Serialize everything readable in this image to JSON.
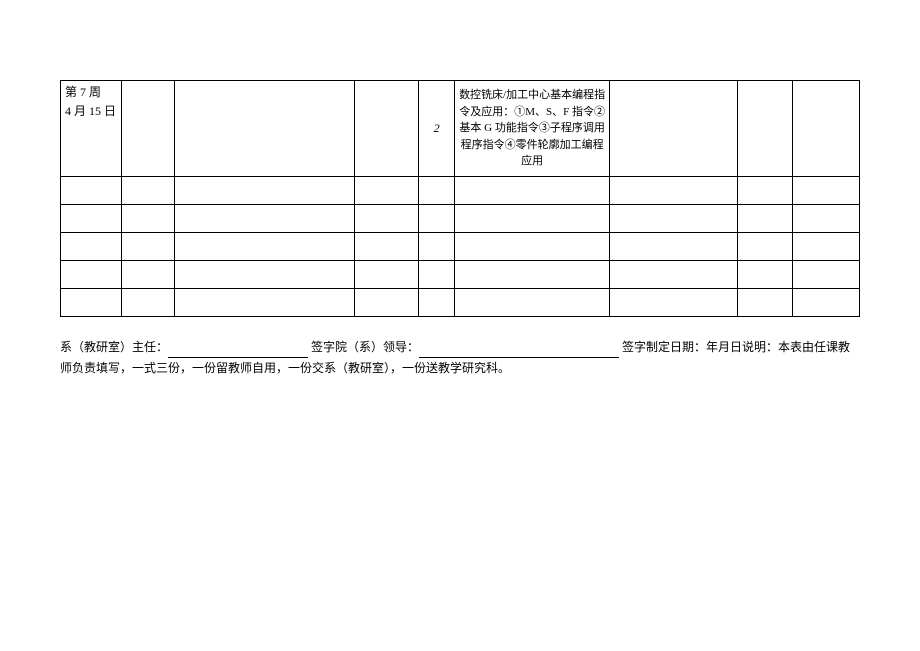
{
  "table": {
    "rows": [
      {
        "week": "第 7 周\n4 月 15 日",
        "col2": "",
        "col3": "",
        "col4": "",
        "hours": "2",
        "content": "数控铣床/加工中心基本编程指令及应用：①M、S、F 指令②基本 G 功能指令③子程序调用程序指令④零件轮廓加工编程应用",
        "col7": "",
        "col8": "",
        "col9": ""
      },
      {
        "week": "",
        "col2": "",
        "col3": "",
        "col4": "",
        "hours": "",
        "content": "",
        "col7": "",
        "col8": "",
        "col9": ""
      },
      {
        "week": "",
        "col2": "",
        "col3": "",
        "col4": "",
        "hours": "",
        "content": "",
        "col7": "",
        "col8": "",
        "col9": ""
      },
      {
        "week": "",
        "col2": "",
        "col3": "",
        "col4": "",
        "hours": "",
        "content": "",
        "col7": "",
        "col8": "",
        "col9": ""
      },
      {
        "week": "",
        "col2": "",
        "col3": "",
        "col4": "",
        "hours": "",
        "content": "",
        "col7": "",
        "col8": "",
        "col9": ""
      },
      {
        "week": "",
        "col2": "",
        "col3": "",
        "col4": "",
        "hours": "",
        "content": "",
        "col7": "",
        "col8": "",
        "col9": ""
      }
    ]
  },
  "footer": {
    "part1": "系（教研室）主任：",
    "part2": "签字院（系）领导：",
    "part3": "签字制定日期：年月日说明：本表由任课教师负责填写，一式三份，一份留教师自用，一份交系（教研室），一份送教学研究科。"
  }
}
